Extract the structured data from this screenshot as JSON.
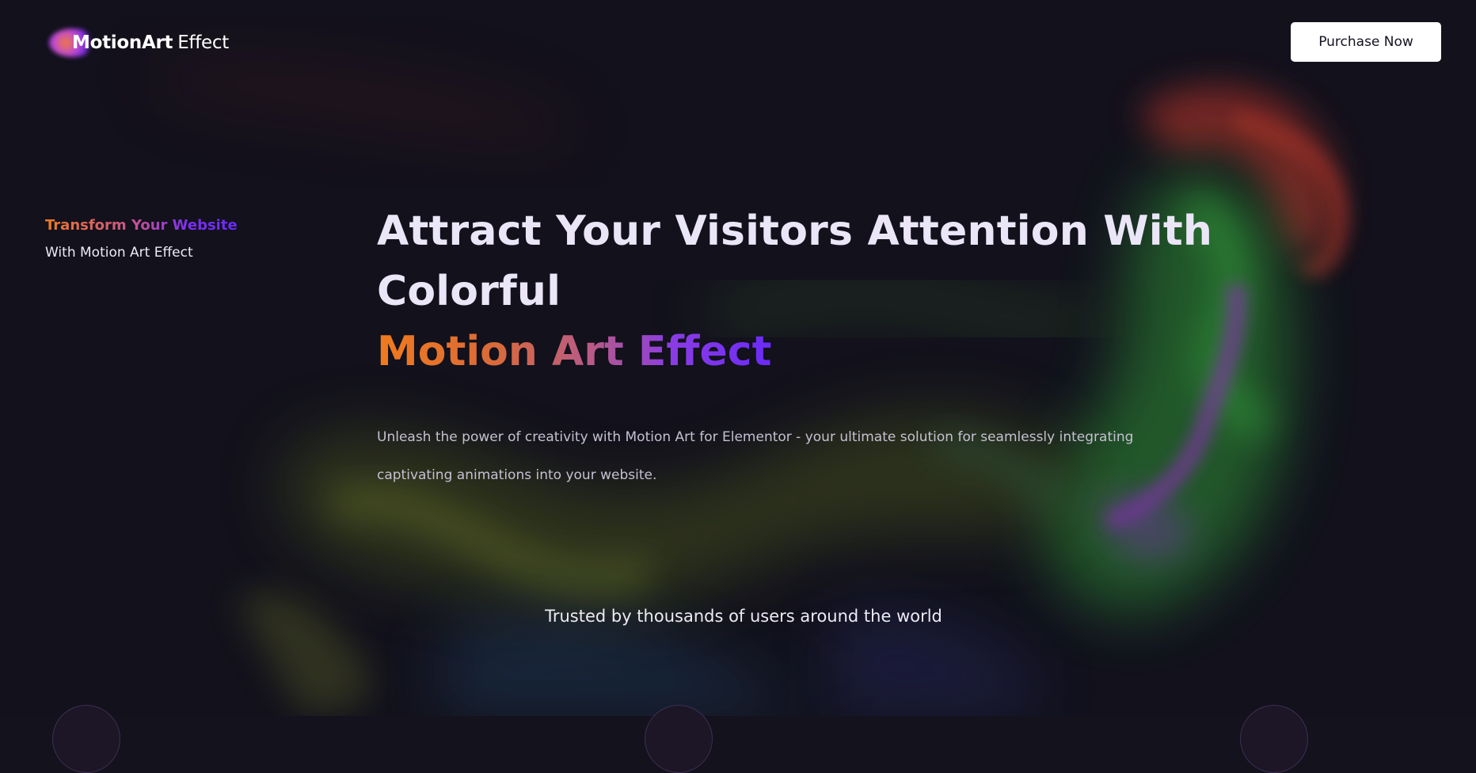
{
  "header": {
    "logo_bold": "MotionArt",
    "logo_light": "Effect",
    "purchase_label": "Purchase Now"
  },
  "side_tag": {
    "line1": "Transform Your Website",
    "line2": "With Motion Art Effect"
  },
  "hero": {
    "title_line1": "Attract Your Visitors Attention With",
    "title_line2": "Colorful",
    "title_accent": "Motion Art Effect",
    "description": "Unleash the power of creativity with Motion Art for Elementor - your ultimate solution for seamlessly integrating captivating animations into your website."
  },
  "trusted": {
    "text": "Trusted by thousands of users around the world"
  },
  "colors": {
    "background": "#13121d",
    "accent_orange": "#f07b1d",
    "accent_purple": "#6a2bf6",
    "button_bg": "#ffffff"
  },
  "icons": {
    "logo_orb": "gradient-orb-icon"
  }
}
